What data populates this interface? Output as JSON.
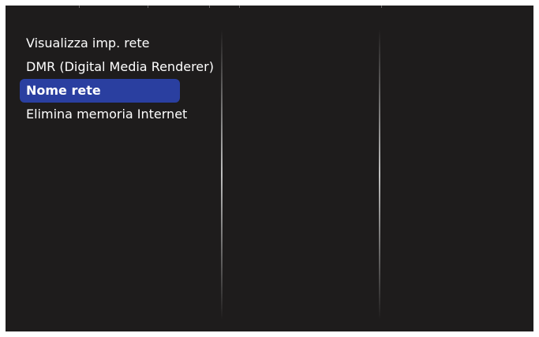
{
  "menu": {
    "items": [
      {
        "label": "Visualizza imp. rete",
        "selected": false
      },
      {
        "label": "DMR (Digital Media Renderer)",
        "selected": false
      },
      {
        "label": "Nome rete",
        "selected": true
      },
      {
        "label": "Elimina memoria Internet",
        "selected": false
      }
    ]
  },
  "colors": {
    "screen_background": "#1e1c1c",
    "selection_highlight": "#2a3fa0",
    "text": "#ffffff",
    "divider": "#bfbfbf"
  }
}
